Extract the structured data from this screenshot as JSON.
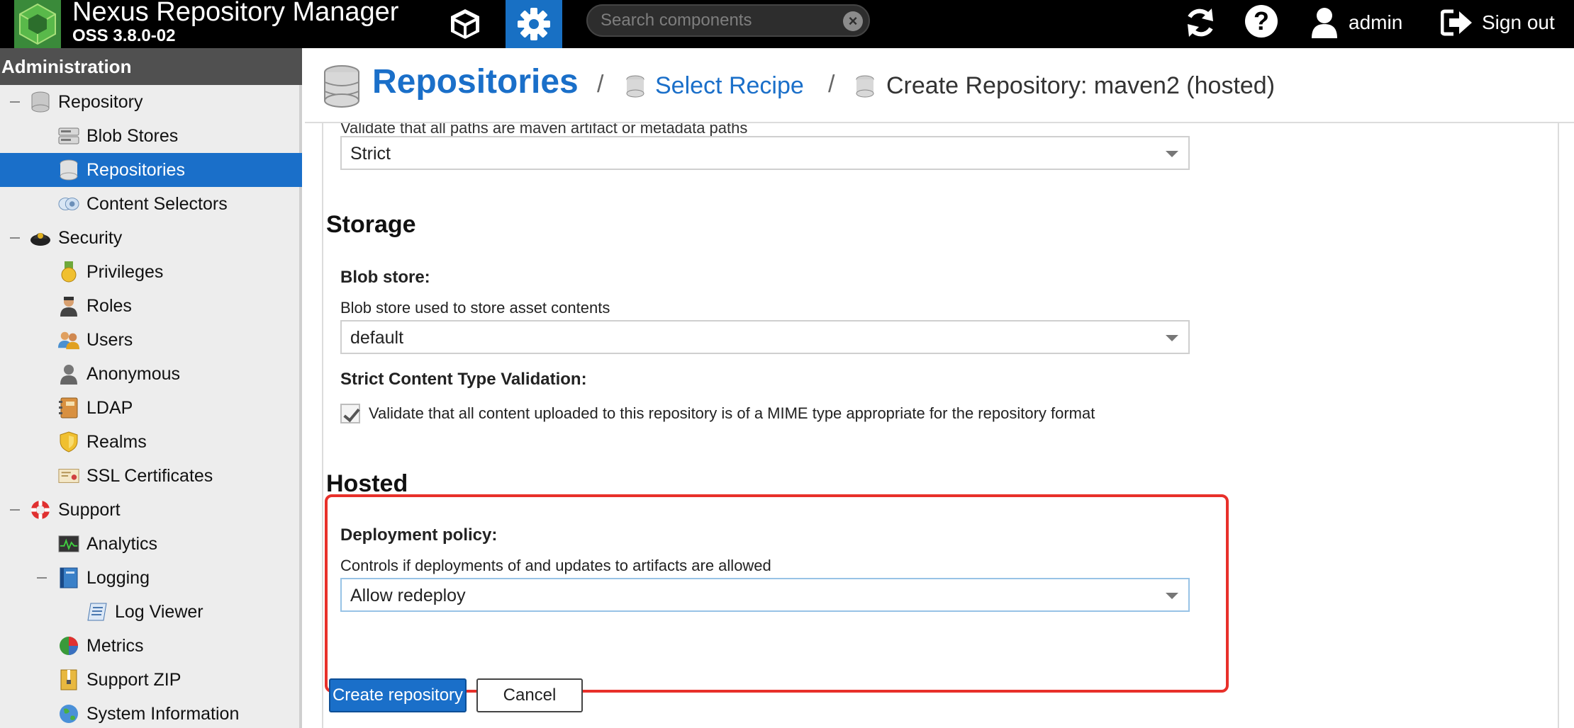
{
  "topbar": {
    "app_title": "Nexus Repository Manager",
    "version": "OSS 3.8.0-02",
    "search_placeholder": "Search components",
    "user": "admin",
    "signout": "Sign out",
    "help": "?"
  },
  "sidebar": {
    "header": "Administration",
    "items": [
      {
        "label": "Repository",
        "icon": "database-icon",
        "level": 0
      },
      {
        "label": "Blob Stores",
        "icon": "blob-store-icon",
        "level": 1
      },
      {
        "label": "Repositories",
        "icon": "database-icon",
        "level": 1,
        "selected": true
      },
      {
        "label": "Content Selectors",
        "icon": "content-selector-icon",
        "level": 1
      },
      {
        "label": "Security",
        "icon": "security-badge-icon",
        "level": 0
      },
      {
        "label": "Privileges",
        "icon": "medal-icon",
        "level": 1
      },
      {
        "label": "Roles",
        "icon": "role-icon",
        "level": 1
      },
      {
        "label": "Users",
        "icon": "users-icon",
        "level": 1
      },
      {
        "label": "Anonymous",
        "icon": "anonymous-icon",
        "level": 1
      },
      {
        "label": "LDAP",
        "icon": "address-book-icon",
        "level": 1
      },
      {
        "label": "Realms",
        "icon": "shield-icon",
        "level": 1
      },
      {
        "label": "SSL Certificates",
        "icon": "certificate-icon",
        "level": 1
      },
      {
        "label": "Support",
        "icon": "lifebuoy-icon",
        "level": 0
      },
      {
        "label": "Analytics",
        "icon": "analytics-icon",
        "level": 1
      },
      {
        "label": "Logging",
        "icon": "book-icon",
        "level": 1
      },
      {
        "label": "Log Viewer",
        "icon": "scroll-icon",
        "level": 2
      },
      {
        "label": "Metrics",
        "icon": "pie-chart-icon",
        "level": 1
      },
      {
        "label": "Support ZIP",
        "icon": "zip-icon",
        "level": 1
      },
      {
        "label": "System Information",
        "icon": "globe-icon",
        "level": 1
      }
    ]
  },
  "breadcrumb": {
    "root": "Repositories",
    "sep1": "/",
    "link": "Select Recipe",
    "sep2": "/",
    "current": "Create Repository: maven2 (hosted)"
  },
  "form": {
    "cut_help": "Validate that all paths are maven artifact or metadata paths",
    "layout_policy_value": "Strict",
    "storage_title": "Storage",
    "blob_store_label": "Blob store:",
    "blob_store_help": "Blob store used to store asset contents",
    "blob_store_value": "default",
    "strict_label": "Strict Content Type Validation:",
    "strict_checkbox_text": "Validate that all content uploaded to this repository is of a MIME type appropriate for the repository format",
    "hosted_title": "Hosted",
    "deployment_label": "Deployment policy:",
    "deployment_help": "Controls if deployments of and updates to artifacts are allowed",
    "deployment_value": "Allow redeploy",
    "create_button": "Create repository",
    "cancel_button": "Cancel"
  },
  "colors": {
    "accent": "#1a6fc9",
    "highlight": "#e8302a",
    "topbar": "#000000",
    "sidebar_header": "#505050"
  }
}
